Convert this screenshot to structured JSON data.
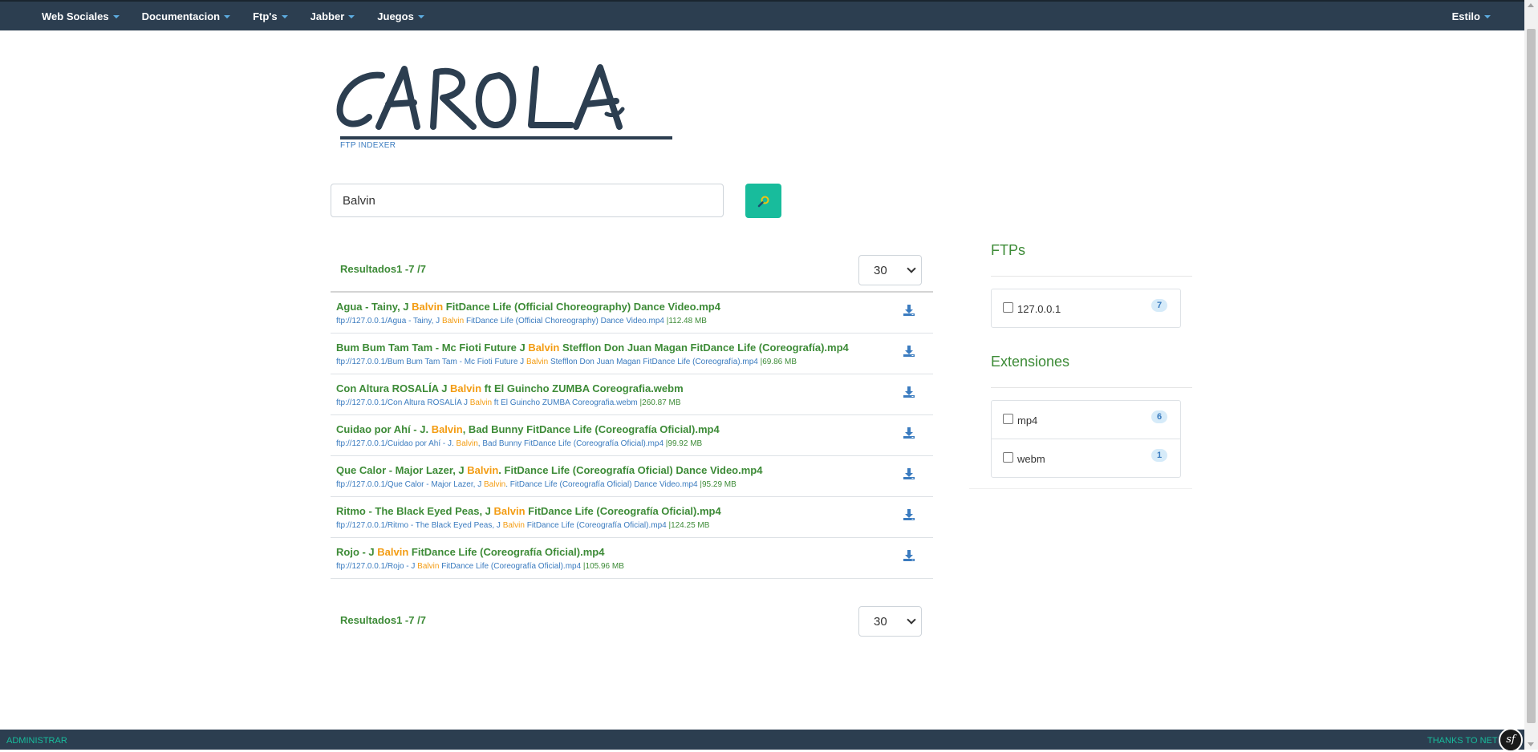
{
  "navbar": {
    "items": [
      {
        "label": "Web Sociales"
      },
      {
        "label": "Documentacion"
      },
      {
        "label": "Ftp's"
      },
      {
        "label": "Jabber"
      },
      {
        "label": "Juegos"
      }
    ],
    "style_label": "Estilo"
  },
  "logo": {
    "text": "CAROLA",
    "subtitle": "FTP INDEXER"
  },
  "search": {
    "value": "Balvin",
    "button_icon": "search-icon"
  },
  "results": {
    "summary": "Resultados1 -7 /7",
    "per_page": "30",
    "items": [
      {
        "title_pre": "Agua - Tainy, J ",
        "title_post": " FitDance Life (Official Choreography) Dance Video.mp4",
        "path_pre": "ftp://127.0.0.1/Agua - Tainy, J ",
        "path_post": " FitDance Life (Official Choreography) Dance Video.mp4",
        "size": " |112.48 MB"
      },
      {
        "title_pre": "Bum Bum Tam Tam - Mc Fioti Future J ",
        "title_post": " Stefflon Don Juan Magan FitDance Life (Coreografía).mp4",
        "path_pre": "ftp://127.0.0.1/Bum Bum Tam Tam - Mc Fioti Future J ",
        "path_post": " Stefflon Don Juan Magan FitDance Life (Coreografía).mp4",
        "size": " |69.86 MB"
      },
      {
        "title_pre": "Con Altura ROSALÍA J ",
        "title_post": " ft El Guincho ZUMBA Coreografia.webm",
        "path_pre": "ftp://127.0.0.1/Con Altura ROSALÍA J ",
        "path_post": " ft El Guincho ZUMBA Coreografia.webm",
        "size": " |260.87 MB"
      },
      {
        "title_pre": "Cuidao por Ahí - J. ",
        "title_post": ", Bad Bunny FitDance Life (Coreografía Oficial).mp4",
        "path_pre": "ftp://127.0.0.1/Cuidao por Ahí - J. ",
        "path_post": ", Bad Bunny FitDance Life (Coreografía Oficial).mp4",
        "size": " |99.92 MB"
      },
      {
        "title_pre": "Que Calor - Major Lazer, J ",
        "title_post": ". FitDance Life (Coreografía Oficial) Dance Video.mp4",
        "path_pre": "ftp://127.0.0.1/Que Calor - Major Lazer, J ",
        "path_post": ". FitDance Life (Coreografía Oficial) Dance Video.mp4",
        "size": " |95.29 MB"
      },
      {
        "title_pre": "Ritmo - The Black Eyed Peas, J ",
        "title_post": " FitDance Life (Coreografía Oficial).mp4",
        "path_pre": "ftp://127.0.0.1/Ritmo - The Black Eyed Peas, J ",
        "path_post": " FitDance Life (Coreografía Oficial).mp4",
        "size": " |124.25 MB"
      },
      {
        "title_pre": "Rojo - J ",
        "title_post": " FitDance Life (Coreografía Oficial).mp4",
        "path_pre": "ftp://127.0.0.1/Rojo - J ",
        "path_post": " FitDance Life (Coreografía Oficial).mp4",
        "size": " |105.96 MB"
      }
    ],
    "highlight": "Balvin",
    "download_icon": "download-icon"
  },
  "sidebar": {
    "ftps_title": "FTPs",
    "ftps": [
      {
        "label": "127.0.0.1",
        "count": "7"
      }
    ],
    "ext_title": "Extensiones",
    "extensions": [
      {
        "label": "mp4",
        "count": "6"
      },
      {
        "label": "webm",
        "count": "1"
      }
    ]
  },
  "footer": {
    "admin": "ADMINISTRAR",
    "thanks": "THANKS TO NET",
    "badge_icon": "symfony-icon",
    "badge_text": "sf"
  },
  "colors": {
    "navbar": "#2c3e50",
    "accent": "#18bc9c",
    "title_green": "#3d8b37",
    "link_blue": "#3a7bbf",
    "highlight_orange": "#f39c12"
  }
}
